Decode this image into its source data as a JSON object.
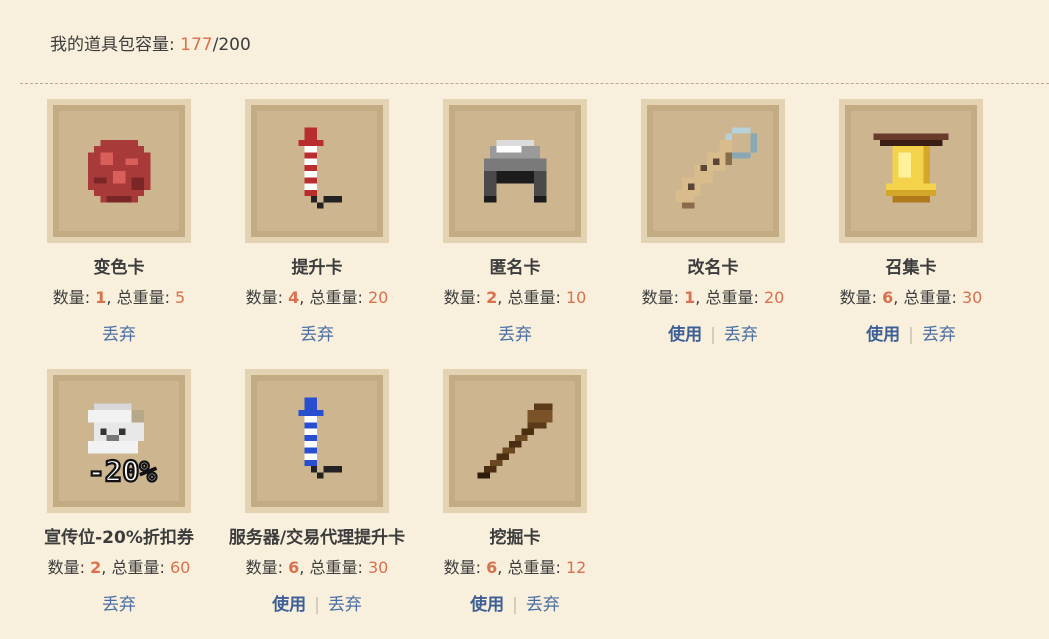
{
  "capacity": {
    "label": "我的道具包容量: ",
    "used": "177",
    "separator": "/",
    "total": "200"
  },
  "labels": {
    "qty": "数量: ",
    "weight": ", 总重量: ",
    "use": "使用",
    "drop": "丢弃",
    "pipe": "|"
  },
  "items": [
    {
      "name": "变色卡",
      "count": "1",
      "weight": "5",
      "usable": false,
      "icon": "red-dye-icon"
    },
    {
      "name": "提升卡",
      "count": "4",
      "weight": "20",
      "usable": false,
      "icon": "red-firework-icon"
    },
    {
      "name": "匿名卡",
      "count": "2",
      "weight": "10",
      "usable": false,
      "icon": "helmet-icon"
    },
    {
      "name": "改名卡",
      "count": "1",
      "weight": "20",
      "usable": true,
      "icon": "name-tag-icon"
    },
    {
      "name": "召集卡",
      "count": "6",
      "weight": "30",
      "usable": true,
      "icon": "bell-icon"
    },
    {
      "name": "宣传位-20%折扣券",
      "count": "2",
      "weight": "60",
      "usable": false,
      "icon": "discount-coupon-icon",
      "badge": "-20%"
    },
    {
      "name": "服务器/交易代理提升卡",
      "count": "6",
      "weight": "30",
      "usable": true,
      "icon": "blue-firework-icon"
    },
    {
      "name": "挖掘卡",
      "count": "6",
      "weight": "12",
      "usable": true,
      "icon": "shovel-icon"
    }
  ]
}
